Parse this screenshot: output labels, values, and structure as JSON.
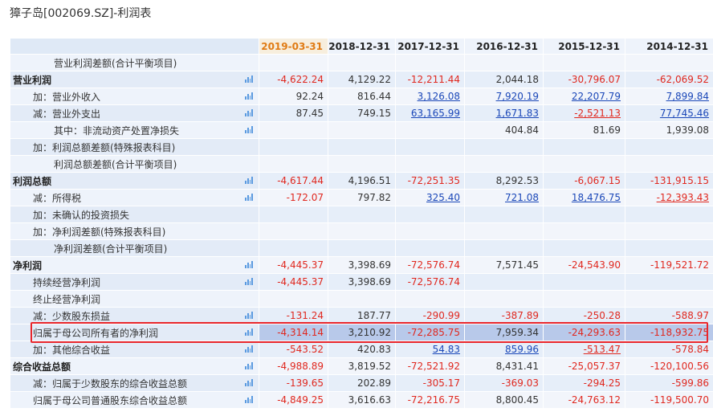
{
  "title": "獐子岛[002069.SZ]-利润表",
  "columns": [
    "2019-03-31",
    "2018-12-31",
    "2017-12-31",
    "2016-12-31",
    "2015-12-31",
    "2014-12-31"
  ],
  "rows": [
    {
      "label": "营业利润差额(合计平衡项目)",
      "indent": 2,
      "chart": false,
      "values": [
        "",
        "",
        "",
        "",
        "",
        ""
      ],
      "styles": [
        "",
        "",
        "",
        "",
        "",
        ""
      ]
    },
    {
      "label": "营业利润",
      "indent": 0,
      "chart": true,
      "values": [
        "-4,622.24",
        "4,129.22",
        "-12,211.44",
        "2,044.18",
        "-30,796.07",
        "-62,069.52"
      ],
      "styles": [
        "neg",
        "pos",
        "neg",
        "pos",
        "neg",
        "neg"
      ]
    },
    {
      "label": "加：营业外收入",
      "indent": 1,
      "chart": true,
      "values": [
        "92.24",
        "816.44",
        "3,126.08",
        "7,920.19",
        "22,207.79",
        "7,899.84"
      ],
      "styles": [
        "pos",
        "pos",
        "link",
        "link",
        "link",
        "link"
      ]
    },
    {
      "label": "减：营业外支出",
      "indent": 1,
      "chart": true,
      "values": [
        "87.45",
        "749.15",
        "63,165.99",
        "1,671.83",
        "-2,521.13",
        "77,745.46"
      ],
      "styles": [
        "pos",
        "pos",
        "link",
        "link",
        "link neg",
        "link"
      ]
    },
    {
      "label": "其中：非流动资产处置净损失",
      "indent": 2,
      "chart": true,
      "values": [
        "",
        "",
        "",
        "404.84",
        "81.69",
        "1,939.08"
      ],
      "styles": [
        "",
        "",
        "",
        "pos",
        "pos",
        "pos"
      ]
    },
    {
      "label": "加：利润总额差额(特殊报表科目)",
      "indent": 1,
      "chart": false,
      "values": [
        "",
        "",
        "",
        "",
        "",
        ""
      ],
      "styles": [
        "",
        "",
        "",
        "",
        "",
        ""
      ]
    },
    {
      "label": "利润总额差额(合计平衡项目)",
      "indent": 2,
      "chart": false,
      "values": [
        "",
        "",
        "",
        "",
        "",
        ""
      ],
      "styles": [
        "",
        "",
        "",
        "",
        "",
        ""
      ]
    },
    {
      "label": "利润总额",
      "indent": 0,
      "chart": true,
      "values": [
        "-4,617.44",
        "4,196.51",
        "-72,251.35",
        "8,292.53",
        "-6,067.15",
        "-131,915.15"
      ],
      "styles": [
        "neg",
        "pos",
        "neg",
        "pos",
        "neg",
        "neg"
      ]
    },
    {
      "label": "减：所得税",
      "indent": 1,
      "chart": true,
      "values": [
        "-172.07",
        "797.82",
        "325.40",
        "721.08",
        "18,476.75",
        "-12,393.43"
      ],
      "styles": [
        "neg",
        "pos",
        "link",
        "link",
        "link",
        "link neg"
      ]
    },
    {
      "label": "加：未确认的投资损失",
      "indent": 1,
      "chart": false,
      "values": [
        "",
        "",
        "",
        "",
        "",
        ""
      ],
      "styles": [
        "",
        "",
        "",
        "",
        "",
        ""
      ]
    },
    {
      "label": "加：净利润差额(特殊报表科目)",
      "indent": 1,
      "chart": false,
      "values": [
        "",
        "",
        "",
        "",
        "",
        ""
      ],
      "styles": [
        "",
        "",
        "",
        "",
        "",
        ""
      ]
    },
    {
      "label": "净利润差额(合计平衡项目)",
      "indent": 2,
      "chart": false,
      "values": [
        "",
        "",
        "",
        "",
        "",
        ""
      ],
      "styles": [
        "",
        "",
        "",
        "",
        "",
        ""
      ]
    },
    {
      "label": "净利润",
      "indent": 0,
      "chart": true,
      "values": [
        "-4,445.37",
        "3,398.69",
        "-72,576.74",
        "7,571.45",
        "-24,543.90",
        "-119,521.72"
      ],
      "styles": [
        "neg",
        "pos",
        "neg",
        "pos",
        "neg",
        "neg"
      ]
    },
    {
      "label": "持续经营净利润",
      "indent": 1,
      "chart": true,
      "values": [
        "-4,445.37",
        "3,398.69",
        "-72,576.74",
        "",
        "",
        ""
      ],
      "styles": [
        "neg",
        "pos",
        "neg",
        "",
        "",
        ""
      ]
    },
    {
      "label": "终止经营净利润",
      "indent": 1,
      "chart": false,
      "values": [
        "",
        "",
        "",
        "",
        "",
        ""
      ],
      "styles": [
        "",
        "",
        "",
        "",
        "",
        ""
      ]
    },
    {
      "label": "减：少数股东损益",
      "indent": 1,
      "chart": true,
      "values": [
        "-131.24",
        "187.77",
        "-290.99",
        "-387.89",
        "-250.28",
        "-588.97"
      ],
      "styles": [
        "neg",
        "pos",
        "neg",
        "neg",
        "neg",
        "neg"
      ]
    },
    {
      "label": "归属于母公司所有者的净利润",
      "indent": 1,
      "chart": true,
      "highlight": true,
      "values": [
        "-4,314.14",
        "3,210.92",
        "-72,285.75",
        "7,959.34",
        "-24,293.63",
        "-118,932.75"
      ],
      "styles": [
        "neg",
        "pos",
        "neg",
        "pos",
        "neg",
        "neg"
      ]
    },
    {
      "label": "加：其他综合收益",
      "indent": 1,
      "chart": true,
      "values": [
        "-543.52",
        "420.83",
        "54.83",
        "859.96",
        "-513.47",
        "-578.84"
      ],
      "styles": [
        "neg",
        "pos",
        "link",
        "link",
        "link neg",
        "neg"
      ]
    },
    {
      "label": "综合收益总额",
      "indent": 0,
      "chart": true,
      "values": [
        "-4,988.89",
        "3,819.52",
        "-72,521.92",
        "8,431.41",
        "-25,057.37",
        "-120,100.56"
      ],
      "styles": [
        "neg",
        "pos",
        "neg",
        "pos",
        "neg",
        "neg"
      ]
    },
    {
      "label": "减：归属于少数股东的综合收益总额",
      "indent": 1,
      "chart": true,
      "values": [
        "-139.65",
        "202.89",
        "-305.17",
        "-369.03",
        "-294.25",
        "-599.86"
      ],
      "styles": [
        "neg",
        "pos",
        "neg",
        "neg",
        "neg",
        "neg"
      ]
    },
    {
      "label": "归属于母公司普通股东综合收益总额",
      "indent": 1,
      "chart": true,
      "values": [
        "-4,849.25",
        "3,616.63",
        "-72,216.75",
        "8,800.45",
        "-24,763.12",
        "-119,500.70"
      ],
      "styles": [
        "neg",
        "pos",
        "neg",
        "pos",
        "neg",
        "neg"
      ]
    }
  ]
}
